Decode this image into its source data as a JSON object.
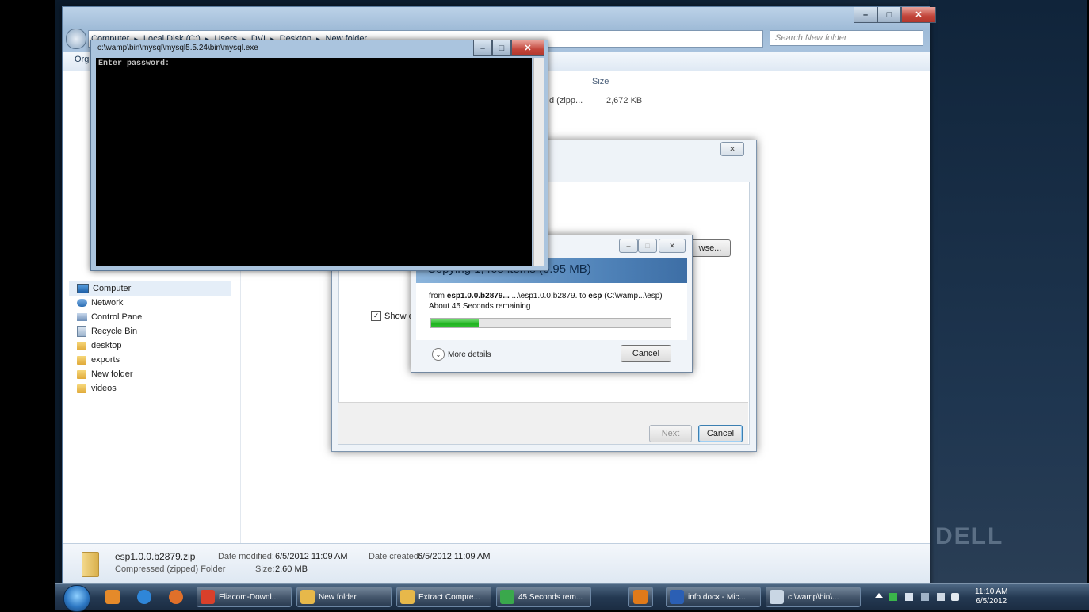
{
  "explorer": {
    "address": [
      "Computer",
      "Local Disk (C:)",
      "Users",
      "DVI",
      "Desktop",
      "New folder"
    ],
    "search_placeholder": "Search New folder",
    "toolbar_organize": "Org",
    "column_size": "Size",
    "row": {
      "type": "d (zipp...",
      "size": "2,672 KB"
    },
    "nav_items": [
      "Computer",
      "Network",
      "Control Panel",
      "Recycle Bin",
      "desktop",
      "exports",
      "New folder",
      "videos"
    ],
    "details": {
      "name": "esp1.0.0.b2879.zip",
      "type": "Compressed (zipped) Folder",
      "modified_label": "Date modified:",
      "modified": "6/5/2012 11:09 AM",
      "created_label": "Date created:",
      "created": "6/5/2012 11:09 AM",
      "size_label": "Size:",
      "size": "2.60 MB"
    }
  },
  "console": {
    "title": "c:\\wamp\\bin\\mysql\\mysql5.5.24\\bin\\mysql.exe",
    "text": "Enter password:"
  },
  "wizard": {
    "show_checkbox_label": "Show extra",
    "browse_label": "wse...",
    "next_label": "Next",
    "cancel_label": "Cancel"
  },
  "copy_dialog": {
    "title": "Copying 1,468 items (6.95 MB)",
    "from_label": "from",
    "source": "esp1.0.0.b2879...",
    "source_path": "...\\esp1.0.0.b2879.",
    "to_label": "to",
    "dest": "esp",
    "dest_path": "(C:\\wamp...\\esp)",
    "time_remaining": "About 45 Seconds remaining",
    "progress": 0.2,
    "more_details_label": "More details",
    "cancel_label": "Cancel"
  },
  "taskbar": {
    "items": [
      {
        "label": "Eliacom-Downl...",
        "color": "#d9402b"
      },
      {
        "label": "New folder",
        "color": "#e7b84a"
      },
      {
        "label": "Extract Compre...",
        "color": "#e7b84a"
      },
      {
        "label": "45 Seconds rem...",
        "color": "#3aa84c"
      },
      {
        "label": "",
        "color": "#e07a1a"
      },
      {
        "label": "info.docx - Mic...",
        "color": "#2b5fb4"
      },
      {
        "label": "c:\\wamp\\bin\\...",
        "color": "#c9d6e4"
      }
    ],
    "time": "11:10 AM",
    "date": "6/5/2012"
  },
  "brand": "DELL"
}
